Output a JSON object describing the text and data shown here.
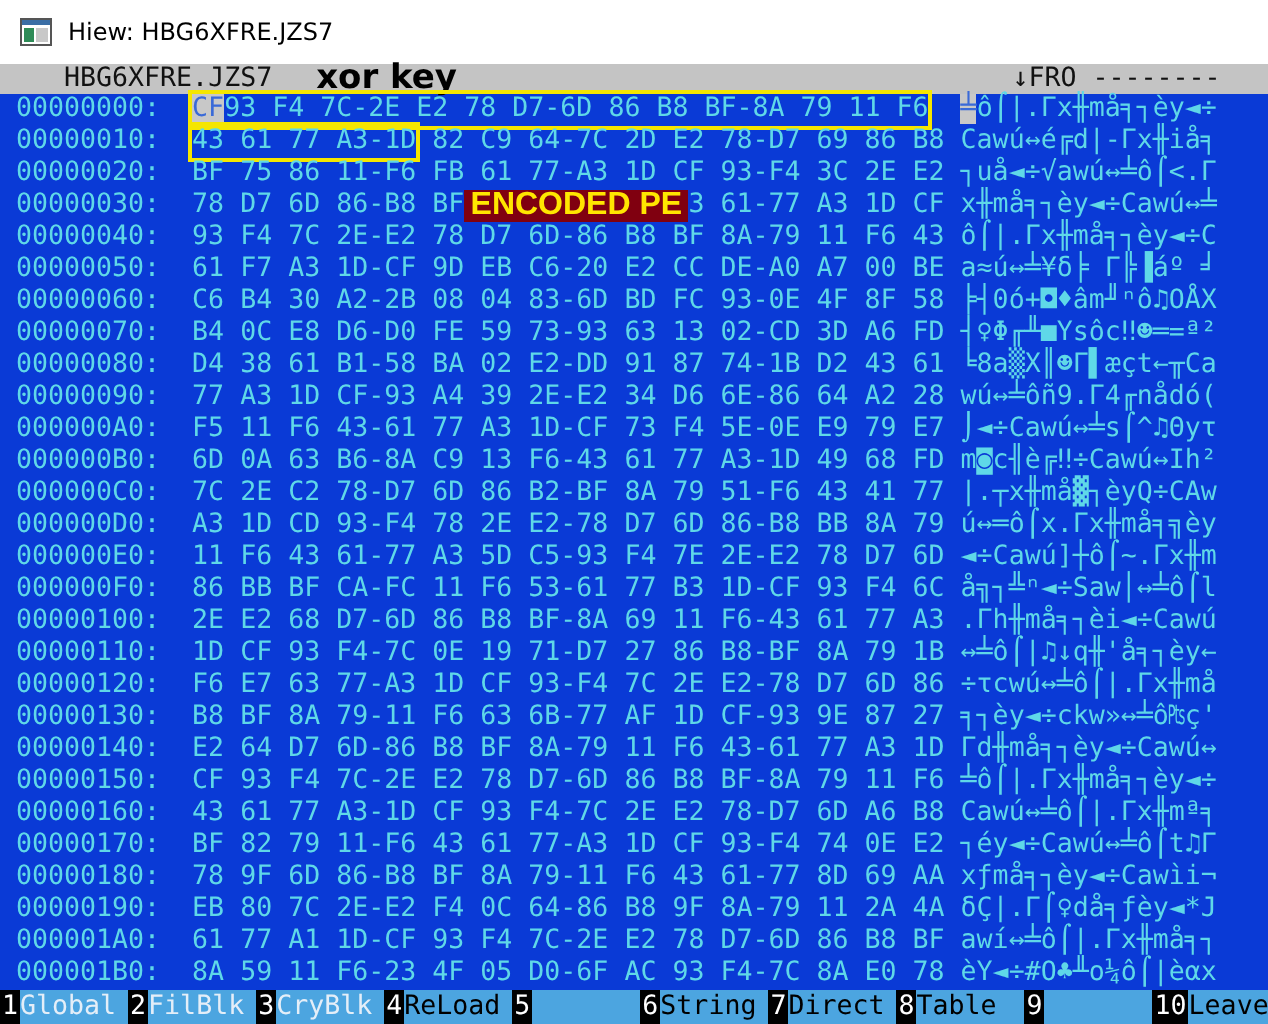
{
  "window": {
    "title": "Hiew: HBG6XFRE.JZS7"
  },
  "header": {
    "file": "HBG6XFRE.JZS7",
    "annotation": "xor key",
    "mode": "↓FRO --------"
  },
  "rows": [
    {
      "offset": "00000000:",
      "parts": [
        {
          "kind": "key",
          "cursor": "CF",
          "text": "93 F4 7C-2E E2 78 D7-6D 86 B8 BF-8A 79 11 F6"
        }
      ],
      "ascii_cursor": "╧",
      "ascii": "ô⌠|.Γx╫må╕┐èy◄÷"
    },
    {
      "offset": "00000010:",
      "parts": [
        {
          "kind": "key",
          "text": "43 61 77 A3-1D"
        },
        {
          "kind": "hex",
          "text": "82 C9 64-7C 2D E2 78-D7 69 86 B8"
        }
      ],
      "ascii": "Cawú↔é╔d|-Γx╫iå╕"
    },
    {
      "offset": "00000020:",
      "parts": [
        {
          "kind": "hex",
          "text": "BF 75 86 11-F6 FB 61 77-A3 1D CF 93-F4 3C 2E E2"
        }
      ],
      "ascii": "┐uå◄÷√awú↔╧ô⌠<.Γ"
    },
    {
      "offset": "00000030:",
      "parts": [
        {
          "kind": "hex",
          "text": "78 D7 6D 86-B8 BF"
        },
        {
          "kind": "note",
          "text": "ENCODED PE"
        },
        {
          "kind": "hex",
          "text": "3 61-77 A3 1D CF"
        }
      ],
      "ascii": "x╫må╕┐èy◄÷Cawú↔╧"
    },
    {
      "offset": "00000040:",
      "parts": [
        {
          "kind": "hex",
          "text": "93 F4 7C 2E-E2 78 D7 6D-86 B8 BF 8A-79 11 F6 43"
        }
      ],
      "ascii": "ô⌠|.Γx╫må╕┐èy◄÷C"
    },
    {
      "offset": "00000050:",
      "parts": [
        {
          "kind": "hex",
          "text": "61 F7 A3 1D-CF 9D EB C6-20 E2 CC DE-A0 A7 00 BE"
        }
      ],
      "ascii": "a≈ú↔╧¥δ╞ Γ╠▐áº ╛"
    },
    {
      "offset": "00000060:",
      "parts": [
        {
          "kind": "hex",
          "text": "C6 B4 30 A2-2B 08 04 83-6D BD FC 93-0E 4F 8F 58"
        }
      ],
      "ascii": "╞┤0ó+◘♦âm╜ⁿô♫OÅX"
    },
    {
      "offset": "00000070:",
      "parts": [
        {
          "kind": "hex",
          "text": "B4 0C E8 D6-D0 FE 59 73-93 63 13 02-CD 3D A6 FD"
        }
      ],
      "ascii": "┤♀Φ╓╨■Ysôc‼☻═=ª²"
    },
    {
      "offset": "00000080:",
      "parts": [
        {
          "kind": "hex",
          "text": "D4 38 61 B1-58 BA 02 E2-DD 91 87 74-1B D2 43 61"
        }
      ],
      "ascii": "╘8a▒X║☻Γ▌æçt←╥Ca"
    },
    {
      "offset": "00000090:",
      "parts": [
        {
          "kind": "hex",
          "text": "77 A3 1D CF-93 A4 39 2E-E2 34 D6 6E-86 64 A2 28"
        }
      ],
      "ascii": "wú↔╧ôñ9.Γ4╓nådó("
    },
    {
      "offset": "000000A0:",
      "parts": [
        {
          "kind": "hex",
          "text": "F5 11 F6 43-61 77 A3 1D-CF 73 F4 5E-0E E9 79 E7"
        }
      ],
      "ascii": "⌡◄÷Cawú↔╧s⌠^♫Θyτ"
    },
    {
      "offset": "000000B0:",
      "parts": [
        {
          "kind": "hex",
          "text": "6D 0A 63 B6-8A C9 13 F6-43 61 77 A3-1D 49 68 FD"
        }
      ],
      "ascii": "m◙c╢è╔‼÷Cawú↔Ih²"
    },
    {
      "offset": "000000C0:",
      "parts": [
        {
          "kind": "hex",
          "text": "7C 2E C2 78-D7 6D 86 B2-BF 8A 79 51-F6 43 41 77"
        }
      ],
      "ascii": "|.┬x╫må▓┐èyQ÷CAw"
    },
    {
      "offset": "000000D0:",
      "parts": [
        {
          "kind": "hex",
          "text": "A3 1D CD 93-F4 78 2E E2-78 D7 6D 86-B8 BB 8A 79"
        }
      ],
      "ascii": "ú↔═ô⌠x.Γx╫må╕╗èy"
    },
    {
      "offset": "000000E0:",
      "parts": [
        {
          "kind": "hex",
          "text": "11 F6 43 61-77 A3 5D C5-93 F4 7E 2E-E2 78 D7 6D"
        }
      ],
      "ascii": "◄÷Cawú]┼ô⌠~.Γx╫m"
    },
    {
      "offset": "000000F0:",
      "parts": [
        {
          "kind": "hex",
          "text": "86 BB BF CA-FC 11 F6 53-61 77 B3 1D-CF 93 F4 6C"
        }
      ],
      "ascii": "å╗┐╩ⁿ◄÷Saw│↔╧ô⌠l"
    },
    {
      "offset": "00000100:",
      "parts": [
        {
          "kind": "hex",
          "text": "2E E2 68 D7-6D 86 B8 BF-8A 69 11 F6-43 61 77 A3"
        }
      ],
      "ascii": ".Γh╫må╕┐èi◄÷Cawú"
    },
    {
      "offset": "00000110:",
      "parts": [
        {
          "kind": "hex",
          "text": "1D CF 93 F4-7C 0E 19 71-D7 27 86 B8-BF 8A 79 1B"
        }
      ],
      "ascii": "↔╧ô⌠|♫↓q╫'å╕┐èy←"
    },
    {
      "offset": "00000120:",
      "parts": [
        {
          "kind": "hex",
          "text": "F6 E7 63 77-A3 1D CF 93-F4 7C 2E E2-78 D7 6D 86"
        }
      ],
      "ascii": "÷τcwú↔╧ô⌠|.Γx╫må"
    },
    {
      "offset": "00000130:",
      "parts": [
        {
          "kind": "hex",
          "text": "B8 BF 8A 79-11 F6 63 6B-77 AF 1D CF-93 9E 87 27"
        }
      ],
      "ascii": "╕┐èy◄÷ckw»↔╧ô₧ç'"
    },
    {
      "offset": "00000140:",
      "parts": [
        {
          "kind": "hex",
          "text": "E2 64 D7 6D-86 B8 BF 8A-79 11 F6 43-61 77 A3 1D"
        }
      ],
      "ascii": "Γd╫må╕┐èy◄÷Cawú↔"
    },
    {
      "offset": "00000150:",
      "parts": [
        {
          "kind": "hex",
          "text": "CF 93 F4 7C-2E E2 78 D7-6D 86 B8 BF-8A 79 11 F6"
        }
      ],
      "ascii": "╧ô⌠|.Γx╫må╕┐èy◄÷"
    },
    {
      "offset": "00000160:",
      "parts": [
        {
          "kind": "hex",
          "text": "43 61 77 A3-1D CF 93 F4-7C 2E E2 78-D7 6D A6 B8"
        }
      ],
      "ascii": "Cawú↔╧ô⌠|.Γx╫mª╕"
    },
    {
      "offset": "00000170:",
      "parts": [
        {
          "kind": "hex",
          "text": "BF 82 79 11-F6 43 61 77-A3 1D CF 93-F4 74 0E E2"
        }
      ],
      "ascii": "┐éy◄÷Cawú↔╧ô⌠t♫Γ"
    },
    {
      "offset": "00000180:",
      "parts": [
        {
          "kind": "hex",
          "text": "78 9F 6D 86-B8 BF 8A 79-11 F6 43 61-77 8D 69 AA"
        }
      ],
      "ascii": "xƒmå╕┐èy◄÷Cawìi¬"
    },
    {
      "offset": "00000190:",
      "parts": [
        {
          "kind": "hex",
          "text": "EB 80 7C 2E-E2 F4 0C 64-86 B8 9F 8A-79 11 2A 4A"
        }
      ],
      "ascii": "δÇ|.Γ⌠♀då╕ƒèy◄*J"
    },
    {
      "offset": "000001A0:",
      "parts": [
        {
          "kind": "hex",
          "text": "61 77 A1 1D-CF 93 F4 7C-2E E2 78 D7-6D 86 B8 BF"
        }
      ],
      "ascii": "awí↔╧ô⌠|.Γx╫må╕┐"
    },
    {
      "offset": "000001B0:",
      "parts": [
        {
          "kind": "hex",
          "text": "8A 59 11 F6-23 4F 05 D0-6F AC 93 F4-7C 8A E0 78"
        }
      ],
      "ascii": "èY◄÷#O♣╨o¼ô⌠|èαx"
    }
  ],
  "function_keys": [
    {
      "key": "1",
      "label": "Global",
      "disabled": true
    },
    {
      "key": "2",
      "label": "FilBlk",
      "disabled": true
    },
    {
      "key": "3",
      "label": "CryBlk",
      "disabled": true
    },
    {
      "key": "4",
      "label": "ReLoad",
      "disabled": false
    },
    {
      "key": "5"
    },
    {
      "key": "6",
      "label": "String",
      "disabled": false
    },
    {
      "key": "7",
      "label": "Direct",
      "disabled": false
    },
    {
      "key": "8",
      "label": "Table",
      "disabled": false
    },
    {
      "key": "9"
    },
    {
      "key": "10",
      "label": "Leave",
      "disabled": false
    }
  ]
}
